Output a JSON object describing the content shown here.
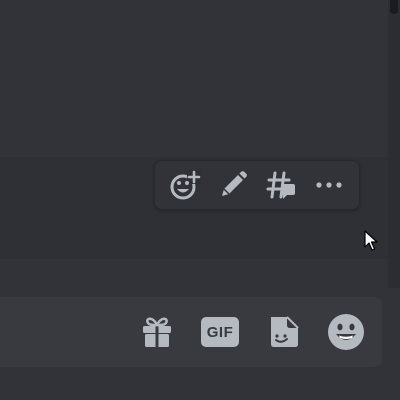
{
  "message_toolbar": {
    "actions": [
      {
        "name": "add-reaction",
        "icon": "smiley-plus-icon"
      },
      {
        "name": "edit",
        "icon": "pencil-icon"
      },
      {
        "name": "create-thread",
        "icon": "thread-icon"
      },
      {
        "name": "more",
        "icon": "more-horizontal-icon"
      }
    ]
  },
  "composer": {
    "input_value": "",
    "gif_label": "GIF",
    "buttons": [
      {
        "name": "gift",
        "icon": "gift-icon"
      },
      {
        "name": "gif",
        "icon": "gif-icon"
      },
      {
        "name": "sticker",
        "icon": "sticker-icon"
      },
      {
        "name": "emoji",
        "icon": "emoji-smile-icon"
      }
    ]
  },
  "colors": {
    "background": "#313338",
    "hover": "#2e3035",
    "composer": "#383a40",
    "icon": "#b5bac1",
    "scrollbar": "#2b2d31"
  }
}
